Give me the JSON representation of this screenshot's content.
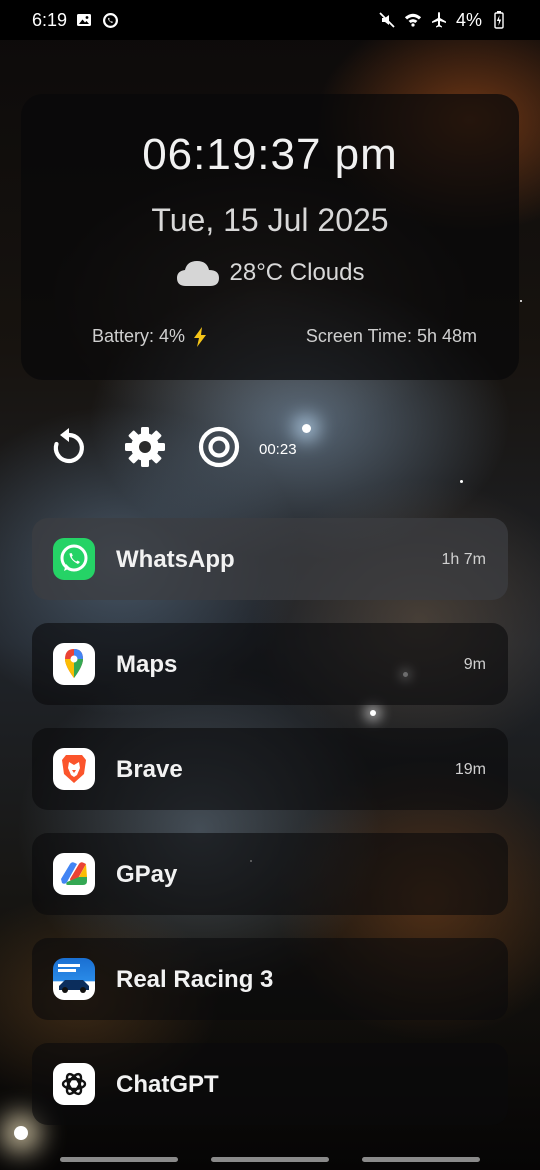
{
  "status_bar": {
    "time": "6:19",
    "battery": "4%",
    "icons": [
      "image-icon",
      "whatsapp-notification-icon",
      "mute-icon",
      "wifi-icon",
      "airplane-mode-icon",
      "battery-charging-icon"
    ]
  },
  "clock_card": {
    "time": "06:19:37 pm",
    "date": "Tue, 15 Jul 2025",
    "weather": "28°C Clouds",
    "weather_icon": "cloud-icon",
    "battery": "Battery: 4%",
    "screen_time": "Screen Time: 5h 48m"
  },
  "controls": {
    "refresh_icon": "refresh-icon",
    "settings_icon": "gear-icon",
    "focus_icon": "target-icon",
    "timer": "00:23"
  },
  "apps": [
    {
      "name": "WhatsApp",
      "usage": "1h 7m",
      "icon": "whatsapp-icon"
    },
    {
      "name": "Maps",
      "usage": "9m",
      "icon": "maps-icon"
    },
    {
      "name": "Brave",
      "usage": "19m",
      "icon": "brave-icon"
    },
    {
      "name": "GPay",
      "usage": "",
      "icon": "gpay-icon"
    },
    {
      "name": "Real Racing 3",
      "usage": "",
      "icon": "real-racing-icon"
    },
    {
      "name": "ChatGPT",
      "usage": "",
      "icon": "chatgpt-icon"
    }
  ],
  "colors": {
    "whatsapp": "#25d366",
    "brave": "#fb542b",
    "accent_bolt": "#f5c518"
  }
}
